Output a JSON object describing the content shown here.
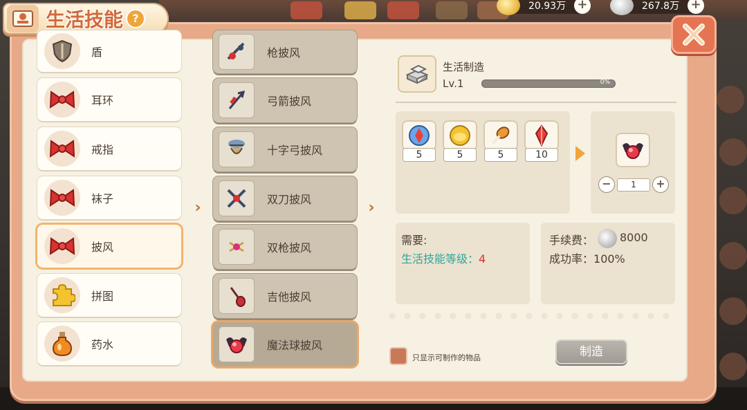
{
  "header": {
    "title": "生活技能",
    "help_label": "?"
  },
  "currency": {
    "gold": "20.93万",
    "silver": "267.8万"
  },
  "categories": [
    {
      "label": "盾",
      "icon": "shield-icon"
    },
    {
      "label": "耳环",
      "icon": "red-bow-icon"
    },
    {
      "label": "戒指",
      "icon": "red-bow-icon"
    },
    {
      "label": "袜子",
      "icon": "red-bow-icon"
    },
    {
      "label": "披风",
      "icon": "red-bow-icon",
      "selected": true
    },
    {
      "label": "拼图",
      "icon": "puzzle-icon"
    },
    {
      "label": "药水",
      "icon": "potion-icon"
    }
  ],
  "items": [
    {
      "label": "枪披风",
      "icon": "gun-cape-icon"
    },
    {
      "label": "弓箭披风",
      "icon": "bow-cape-icon"
    },
    {
      "label": "十字弓披风",
      "icon": "crossbow-cape-icon"
    },
    {
      "label": "双刀披风",
      "icon": "dual-blade-cape-icon"
    },
    {
      "label": "双枪披风",
      "icon": "dual-gun-cape-icon"
    },
    {
      "label": "吉他披风",
      "icon": "guitar-cape-icon"
    },
    {
      "label": "魔法球披风",
      "icon": "magic-orb-cape-icon",
      "selected": true
    }
  ],
  "craft": {
    "name": "生活制造",
    "level": "Lv.1",
    "exp_percent_text": "0%",
    "exp_progress": 0
  },
  "materials": [
    {
      "icon": "blue-crystal-icon",
      "count": "5"
    },
    {
      "icon": "gold-nugget-icon",
      "count": "5"
    },
    {
      "icon": "drumstick-icon",
      "count": "5"
    },
    {
      "icon": "red-crystal-icon",
      "count": "10"
    }
  ],
  "result": {
    "icon": "magic-orb-cape-icon",
    "quantity": "1",
    "minus_label": "−",
    "plus_label": "+"
  },
  "requirements": {
    "title": "需要:",
    "skill_label": "生活技能等级：",
    "skill_value": "4"
  },
  "cost": {
    "fee_label": "手续费：",
    "fee_value": "8000",
    "rate_label": "成功率：",
    "rate_value": "100%"
  },
  "footer": {
    "filter_label": "只显示可制作的物品",
    "craft_button": "制造"
  },
  "colors": {
    "panel": "#e7a987",
    "accent": "#f0a53a",
    "skill_text": "#2aa79a",
    "skill_value": "#d8322f"
  }
}
